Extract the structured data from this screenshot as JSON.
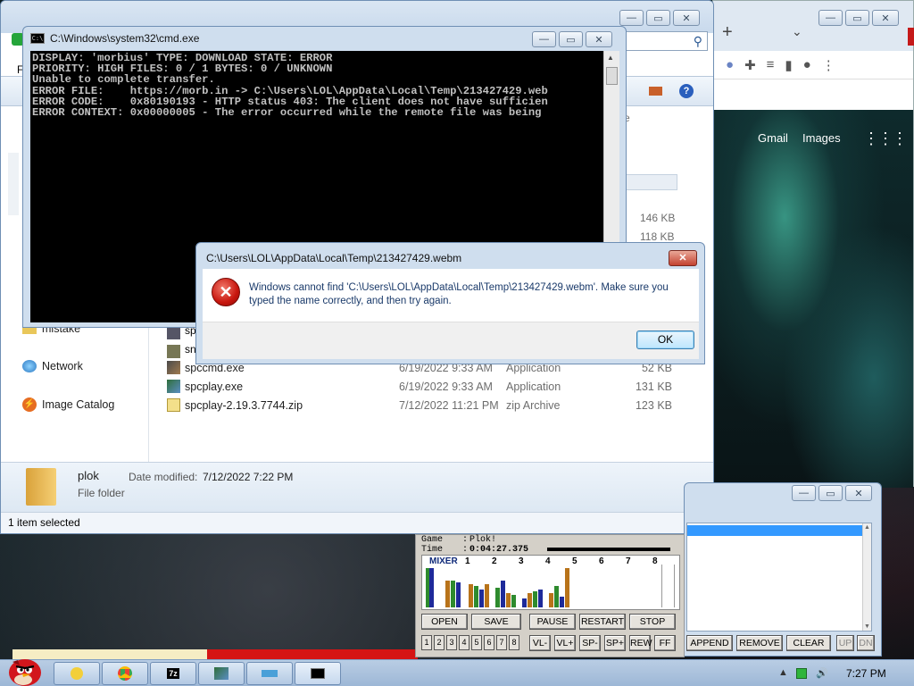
{
  "chrome": {
    "new_tab": "+",
    "tab_dropdown": "⌄",
    "toolbar_icons": [
      "extension-icon",
      "reading-list-icon",
      "side-panel-icon",
      "profile-icon",
      "menu-icon"
    ],
    "gmail": "Gmail",
    "images": "Images",
    "apps": "⋮⋮⋮",
    "controls": {
      "minimize": "—",
      "maximize": "▭",
      "close": "✕"
    }
  },
  "explorer": {
    "menu_letter": "F",
    "view_col": "e",
    "nav": [
      {
        "label": "mistake",
        "icon": "folder-icon"
      },
      {
        "label": "Network",
        "icon": "network-icon"
      },
      {
        "label": "Image Catalog",
        "icon": "image-catalog-icon"
      }
    ],
    "sizes_top": [
      "146 KB",
      "118 KB"
    ],
    "partial_names": [
      "sp",
      "sn"
    ],
    "files": [
      {
        "name": "spccmd.exe",
        "date": "6/19/2022 9:33 AM",
        "type": "Application",
        "size": "52 KB",
        "icon": "exe-icon"
      },
      {
        "name": "spcplay.exe",
        "date": "6/19/2022 9:33 AM",
        "type": "Application",
        "size": "131 KB",
        "icon": "exe-icon"
      },
      {
        "name": "spcplay-2.19.3.7744.zip",
        "date": "7/12/2022 11:21 PM",
        "type": "zip Archive",
        "size": "123 KB",
        "icon": "zip-icon"
      }
    ],
    "details": {
      "name": "plok",
      "modified_label": "Date modified:",
      "modified": "7/12/2022 7:22 PM",
      "kind": "File folder"
    },
    "status": "1 item selected",
    "controls": {
      "minimize": "—",
      "maximize": "▭",
      "close": "✕"
    }
  },
  "cmd": {
    "title": "C:\\Windows\\system32\\cmd.exe",
    "icon_text": "C:\\",
    "lines": [
      "DISPLAY: 'morbius' TYPE: DOWNLOAD STATE: ERROR",
      "PRIORITY: HIGH FILES: 0 / 1 BYTES: 0 / UNKNOWN",
      "Unable to complete transfer.",
      "ERROR FILE:    https://morb.in -> C:\\Users\\LOL\\AppData\\Local\\Temp\\213427429.web",
      "ERROR CODE:    0x80190193 - HTTP status 403: The client does not have sufficien",
      "ERROR CONTEXT: 0x00000005 - The error occurred while the remote file was being"
    ],
    "controls": {
      "minimize": "—",
      "maximize": "▭",
      "close": "✕"
    }
  },
  "dialog": {
    "title": "C:\\Users\\LOL\\AppData\\Local\\Temp\\213427429.webm",
    "message": "Windows cannot find 'C:\\Users\\LOL\\AppData\\Local\\Temp\\213427429.webm'. Make sure you typed the name correctly, and then try again.",
    "ok": "OK",
    "close": "✕"
  },
  "playlist": {
    "controls": {
      "minimize": "—",
      "maximize": "▭",
      "close": "✕"
    },
    "append": "APPEND",
    "remove": "REMOVE",
    "clear": "CLEAR",
    "up": "UP",
    "dn": "DN"
  },
  "spc": {
    "game_label": "Game",
    "game_value": "Plok!",
    "time_label": "Time",
    "time_value": "0:04:27.375",
    "mixer_label": "MIXER",
    "channels": [
      "1",
      "2",
      "3",
      "4",
      "5",
      "6",
      "7",
      "8"
    ],
    "buttons": {
      "open": "OPEN",
      "save": "SAVE",
      "pause": "PAUSE",
      "restart": "RESTART",
      "stop": "STOP",
      "vl_minus": "VL-",
      "vl_plus": "VL+",
      "sp_minus": "SP-",
      "sp_plus": "SP+",
      "rew": "REW",
      "ff": "FF"
    },
    "channel_toggles": [
      "1",
      "2",
      "3",
      "4",
      "5",
      "6",
      "7",
      "8"
    ]
  },
  "taskbar": {
    "clock": "7:27 PM",
    "tray_arrow": "▲",
    "speaker": "🔊"
  }
}
